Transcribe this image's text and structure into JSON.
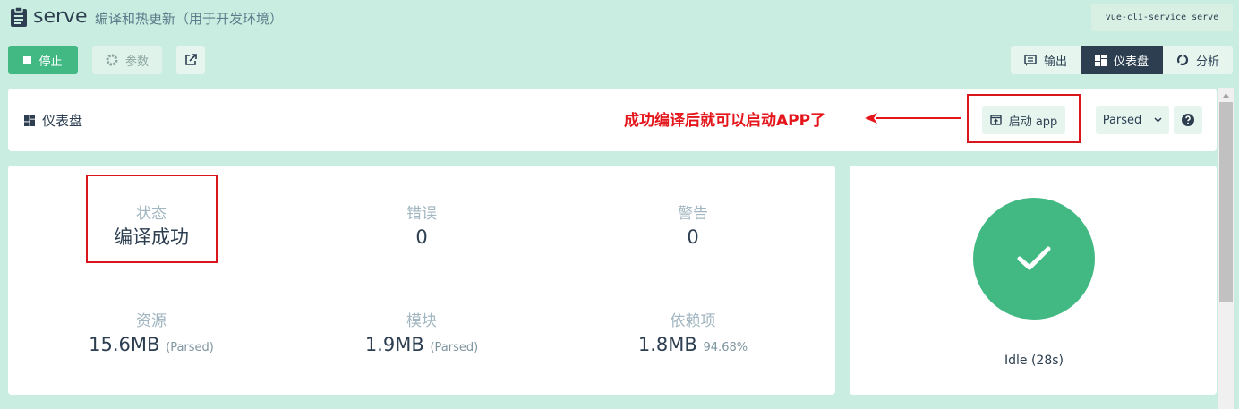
{
  "header": {
    "title": "serve",
    "subtitle": "编译和热更新（用于开发环境）",
    "command": "vue-cli-service serve"
  },
  "toolbar": {
    "stop_label": "停止",
    "params_label": "参数",
    "view_tabs": [
      {
        "label": "输出",
        "icon": "output-icon",
        "active": false
      },
      {
        "label": "仪表盘",
        "icon": "dashboard-icon",
        "active": true
      },
      {
        "label": "分析",
        "icon": "analysis-icon",
        "active": false
      }
    ]
  },
  "dashboard": {
    "title": "仪表盘",
    "annotation": "成功编译后就可以启动APP了",
    "start_app_label": "启动 app",
    "size_mode": "Parsed"
  },
  "stats": {
    "status": {
      "label": "状态",
      "value": "编译成功"
    },
    "errors": {
      "label": "错误",
      "value": "0"
    },
    "warnings": {
      "label": "警告",
      "value": "0"
    },
    "assets": {
      "label": "资源",
      "value": "15.6MB",
      "suffix": "(Parsed)"
    },
    "modules": {
      "label": "模块",
      "value": "1.9MB",
      "suffix": "(Parsed)"
    },
    "dependencies": {
      "label": "依赖项",
      "value": "1.8MB",
      "suffix": "94.68%"
    }
  },
  "status_panel": {
    "idle": "Idle (28s)"
  },
  "colors": {
    "background": "#c9ede0",
    "accent": "#42b983",
    "dark": "#2c3e50",
    "annotation": "#e4161b"
  }
}
